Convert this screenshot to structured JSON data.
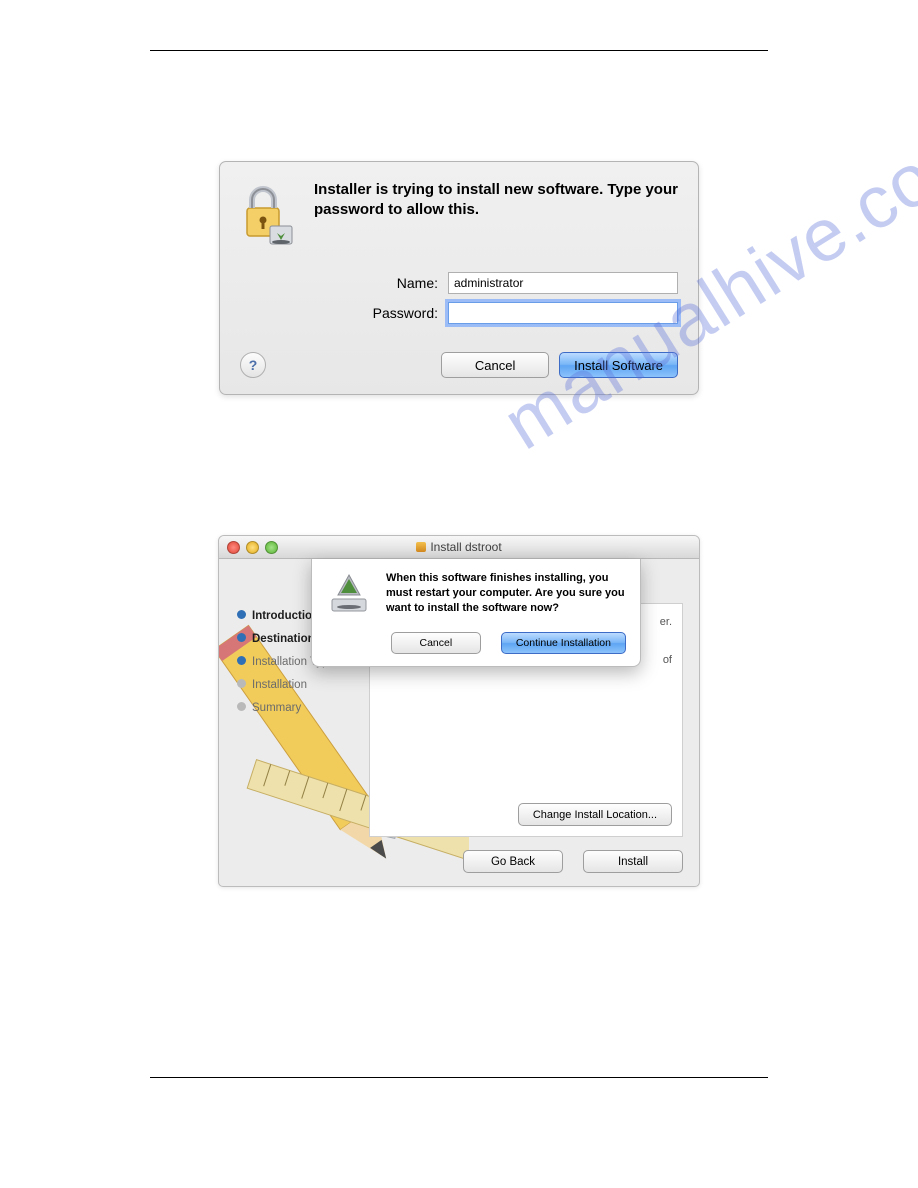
{
  "auth_dialog": {
    "headline": "Installer is trying to install new software. Type your password to allow this.",
    "name_label": "Name:",
    "name_value": "administrator",
    "password_label": "Password:",
    "password_value": "",
    "cancel_label": "Cancel",
    "install_label": "Install Software",
    "help_label": "?"
  },
  "installer_window": {
    "title": "Install dstroot",
    "steps": {
      "introduction": "Introduction",
      "destination": "Destination",
      "install_type": "Installation Type",
      "installation": "Installation",
      "summary": "Summary"
    },
    "change_location_label": "Change Install Location...",
    "go_back_label": "Go Back",
    "install_label": "Install",
    "sheet": {
      "message": "When this software finishes installing, you must restart your computer. Are you sure you want to install the software now?",
      "cancel_label": "Cancel",
      "continue_label": "Continue Installation"
    },
    "hidden_text_right_1": "er.",
    "hidden_text_right_2": "of"
  },
  "watermark_text": "manualhive.com"
}
